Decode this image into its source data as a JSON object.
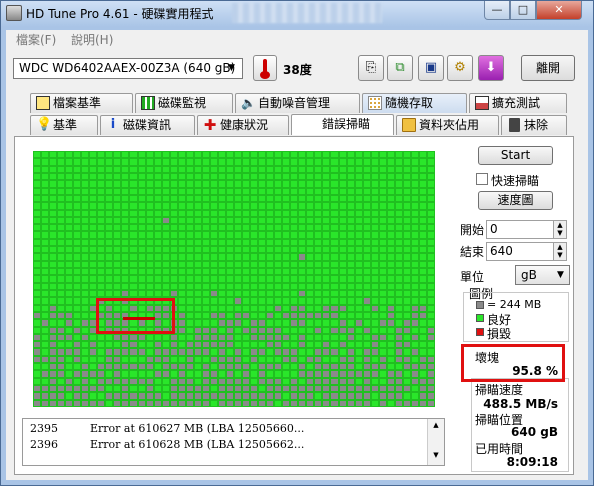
{
  "window": {
    "title": "HD Tune Pro 4.61 - 硬碟實用程式",
    "min_label": "—",
    "max_label": "□",
    "close_label": "✕"
  },
  "menu": {
    "file": "檔案(F)",
    "help": "說明(H)"
  },
  "toolbar": {
    "drive": "WDC WD6402AAEX-00Z3A    (640 gB)",
    "temperature": "38度",
    "exit_label": "離開"
  },
  "tabs_row1": [
    {
      "label": "檔案基準",
      "icon": "file-benchmark-icon"
    },
    {
      "label": "磁碟監視",
      "icon": "disk-monitor-icon"
    },
    {
      "label": "自動噪音管理",
      "icon": "speaker-icon"
    },
    {
      "label": "隨機存取",
      "icon": "random-access-icon"
    },
    {
      "label": "擴充測試",
      "icon": "extra-tests-icon"
    }
  ],
  "tabs_row2": [
    {
      "label": "基準",
      "icon": "bulb-icon"
    },
    {
      "label": "磁碟資訊",
      "icon": "info-icon"
    },
    {
      "label": "健康狀況",
      "icon": "health-cross-icon"
    },
    {
      "label": "錯誤掃瞄",
      "icon": ""
    },
    {
      "label": "資料夾佔用",
      "icon": "folder-icon"
    },
    {
      "label": "抹除",
      "icon": "trash-icon"
    }
  ],
  "log": [
    {
      "index": "2395",
      "text": "Error at 610627 MB (LBA 12505660..."
    },
    {
      "index": "2396",
      "text": "Error at 610628 MB (LBA 12505662..."
    }
  ],
  "controls": {
    "start_label": "Start",
    "quick_scan_label": "快速掃瞄",
    "quick_scan_checked": false,
    "speed_map_label": "速度圖",
    "start_label_text": "開始",
    "start_value": "0",
    "end_label_text": "結束",
    "end_value": "640",
    "unit_label": "單位",
    "unit_value": "gB"
  },
  "legend": {
    "title": "圖例",
    "block_size": "= 244 MB",
    "good": "良好",
    "bad": "損毀",
    "colors": {
      "block": "#8a8a8a",
      "good": "#2ae62a",
      "bad": "#e01010"
    }
  },
  "stats": {
    "damaged_label": "壞塊",
    "damaged_value": "95.8 %",
    "speed_label": "掃瞄速度",
    "speed_value": "488.5 MB/s",
    "position_label": "掃瞄位置",
    "position_value": "640 gB",
    "elapsed_label": "已用時間",
    "elapsed_value": "8:09:18"
  }
}
